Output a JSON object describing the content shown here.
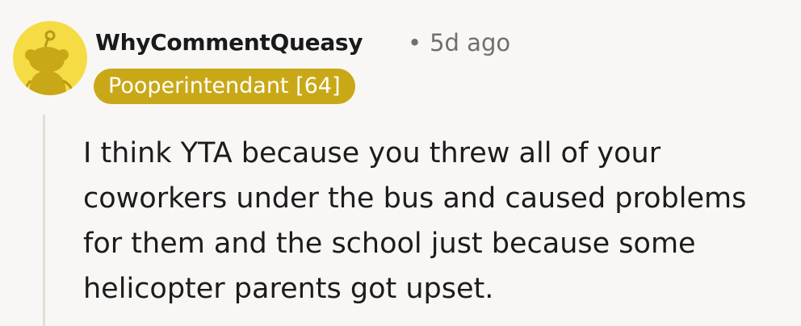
{
  "comment": {
    "author": "WhyCommentQueasy",
    "separator": "•",
    "timestamp": "5d ago",
    "flair": "Pooperintendant [64]",
    "body": "I think YTA because you threw all of your coworkers under the bus and caused problems for them and the school just because some helicopter parents got upset.",
    "avatar_icon": "reddit-snoo-avatar-icon",
    "colors": {
      "avatar_bg": "#f5dc45",
      "avatar_shade": "#c9a817",
      "flair_bg": "#c9a817",
      "flair_text": "#ffffff",
      "meta_text": "#6f6f6f",
      "thread_line": "#e4ddd4"
    }
  }
}
